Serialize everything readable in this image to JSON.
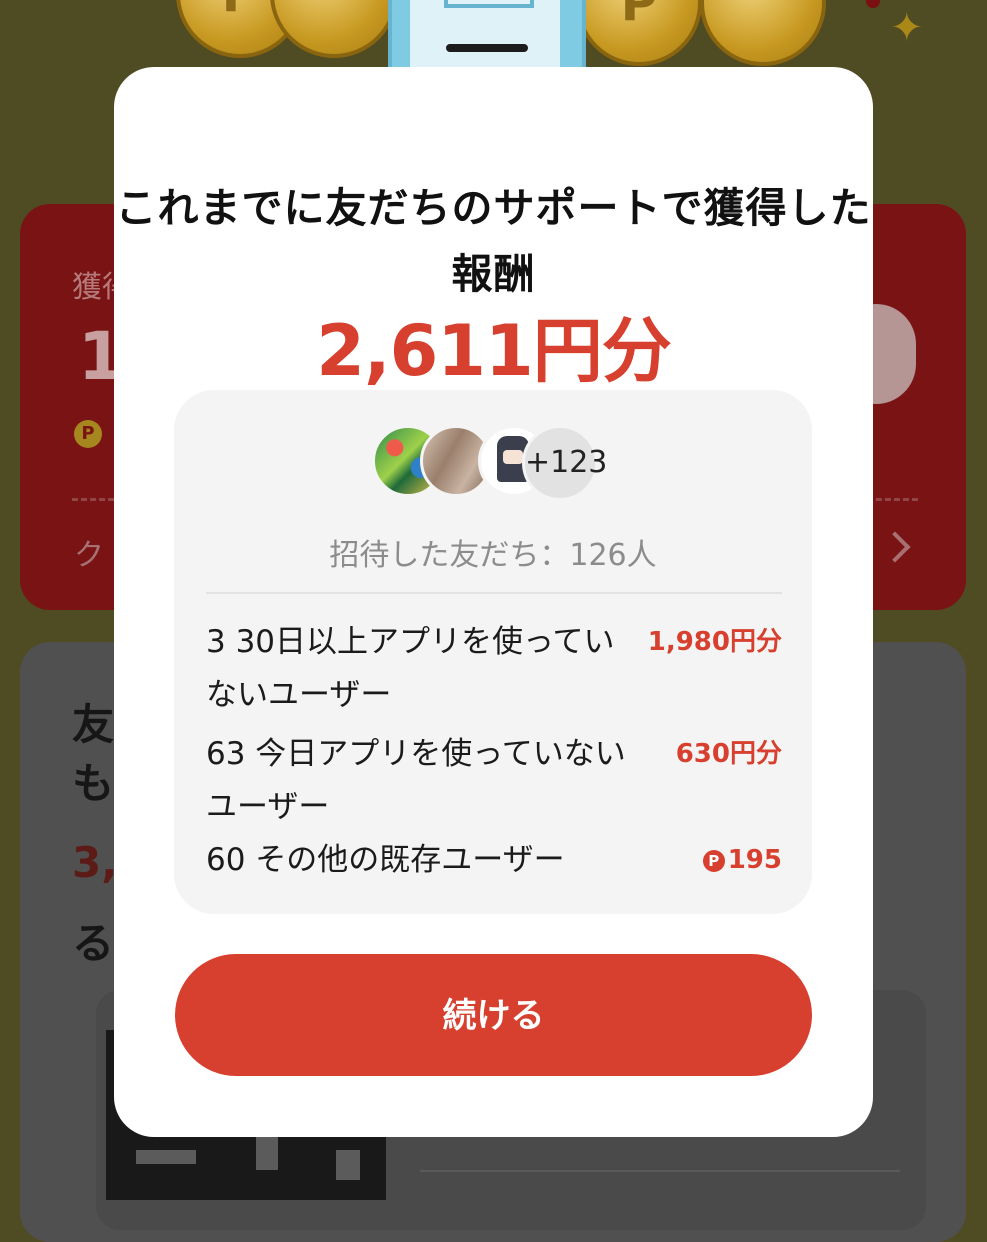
{
  "background": {
    "earnings_label": "獲得",
    "earnings_value": "1",
    "coupon_link": "ク",
    "invite_heading": "友も",
    "invite_amount": "3,",
    "invite_suffix": "る"
  },
  "modal": {
    "title": "これまでに友だちのサポートで獲得した報酬",
    "total": "2,611円分",
    "avatars_more": "+123",
    "invited_count": "招待した友だち：126人",
    "rows": [
      {
        "label": "3 30日以上アプリを使っていないユーザー",
        "value": "1,980円分",
        "points": false
      },
      {
        "label": "63 今日アプリを使っていないユーザー",
        "value": "630円分",
        "points": false
      },
      {
        "label": "60 その他の既存ユーザー",
        "value": "195",
        "points": true
      }
    ],
    "continue_label": "続ける"
  },
  "colors": {
    "accent": "#d7402f",
    "overlay": "#4f4b23",
    "modal_bg": "#ffffff",
    "panel_bg": "#f4f4f4"
  },
  "icons": {
    "point": "P"
  }
}
